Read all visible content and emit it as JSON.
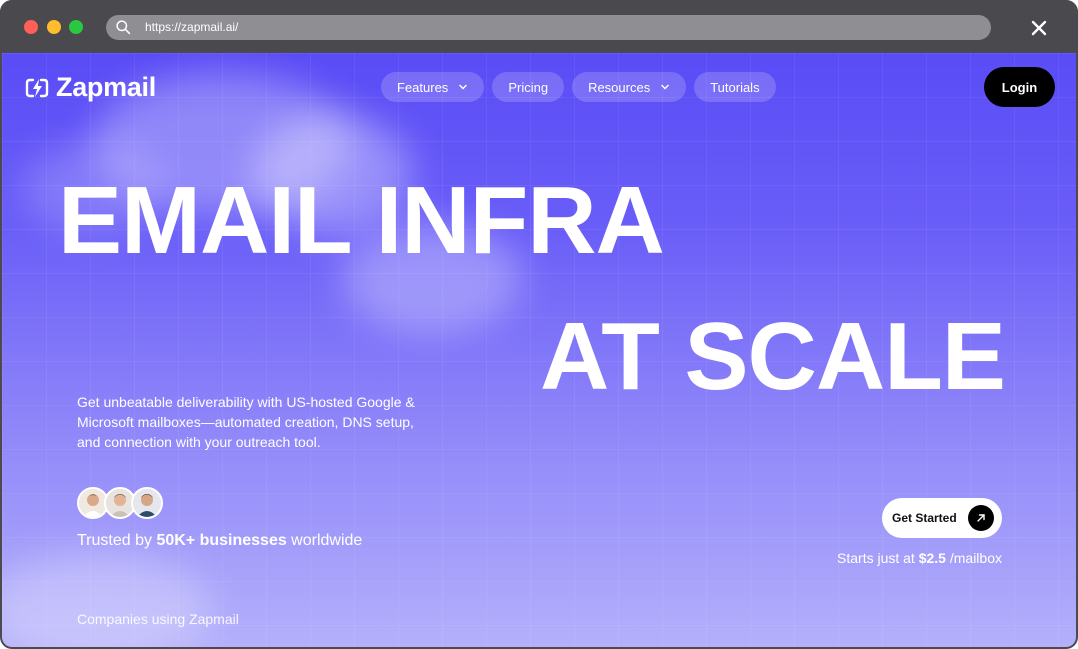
{
  "browser": {
    "url": "https://zapmail.ai/",
    "icons": {
      "search": "search-icon",
      "close": "close-icon"
    }
  },
  "nav": {
    "logo_text": "Zapmail",
    "items": [
      {
        "label": "Features",
        "has_dropdown": true
      },
      {
        "label": "Pricing",
        "has_dropdown": false
      },
      {
        "label": "Resources",
        "has_dropdown": true
      },
      {
        "label": "Tutorials",
        "has_dropdown": false
      }
    ],
    "login_label": "Login"
  },
  "hero": {
    "headline_line1": "EMAIL INFRA",
    "headline_line2": "AT SCALE",
    "subtext": "Get unbeatable deliverability with US-hosted Google & Microsoft mailboxes—automated creation, DNS setup, and connection with your outreach tool.",
    "trusted_prefix": "Trusted by ",
    "trusted_bold": "50K+ businesses",
    "trusted_suffix": " worldwide",
    "cta_label": "Get Started",
    "price_prefix": "Starts just at ",
    "price_bold": "$2.5",
    "price_suffix": " /mailbox",
    "companies_label": "Companies using Zapmail"
  },
  "colors": {
    "accent": "#5a4cf6",
    "accent_light": "#b4b0fb",
    "login_bg": "#000000",
    "cta_bg": "#ffffff"
  }
}
